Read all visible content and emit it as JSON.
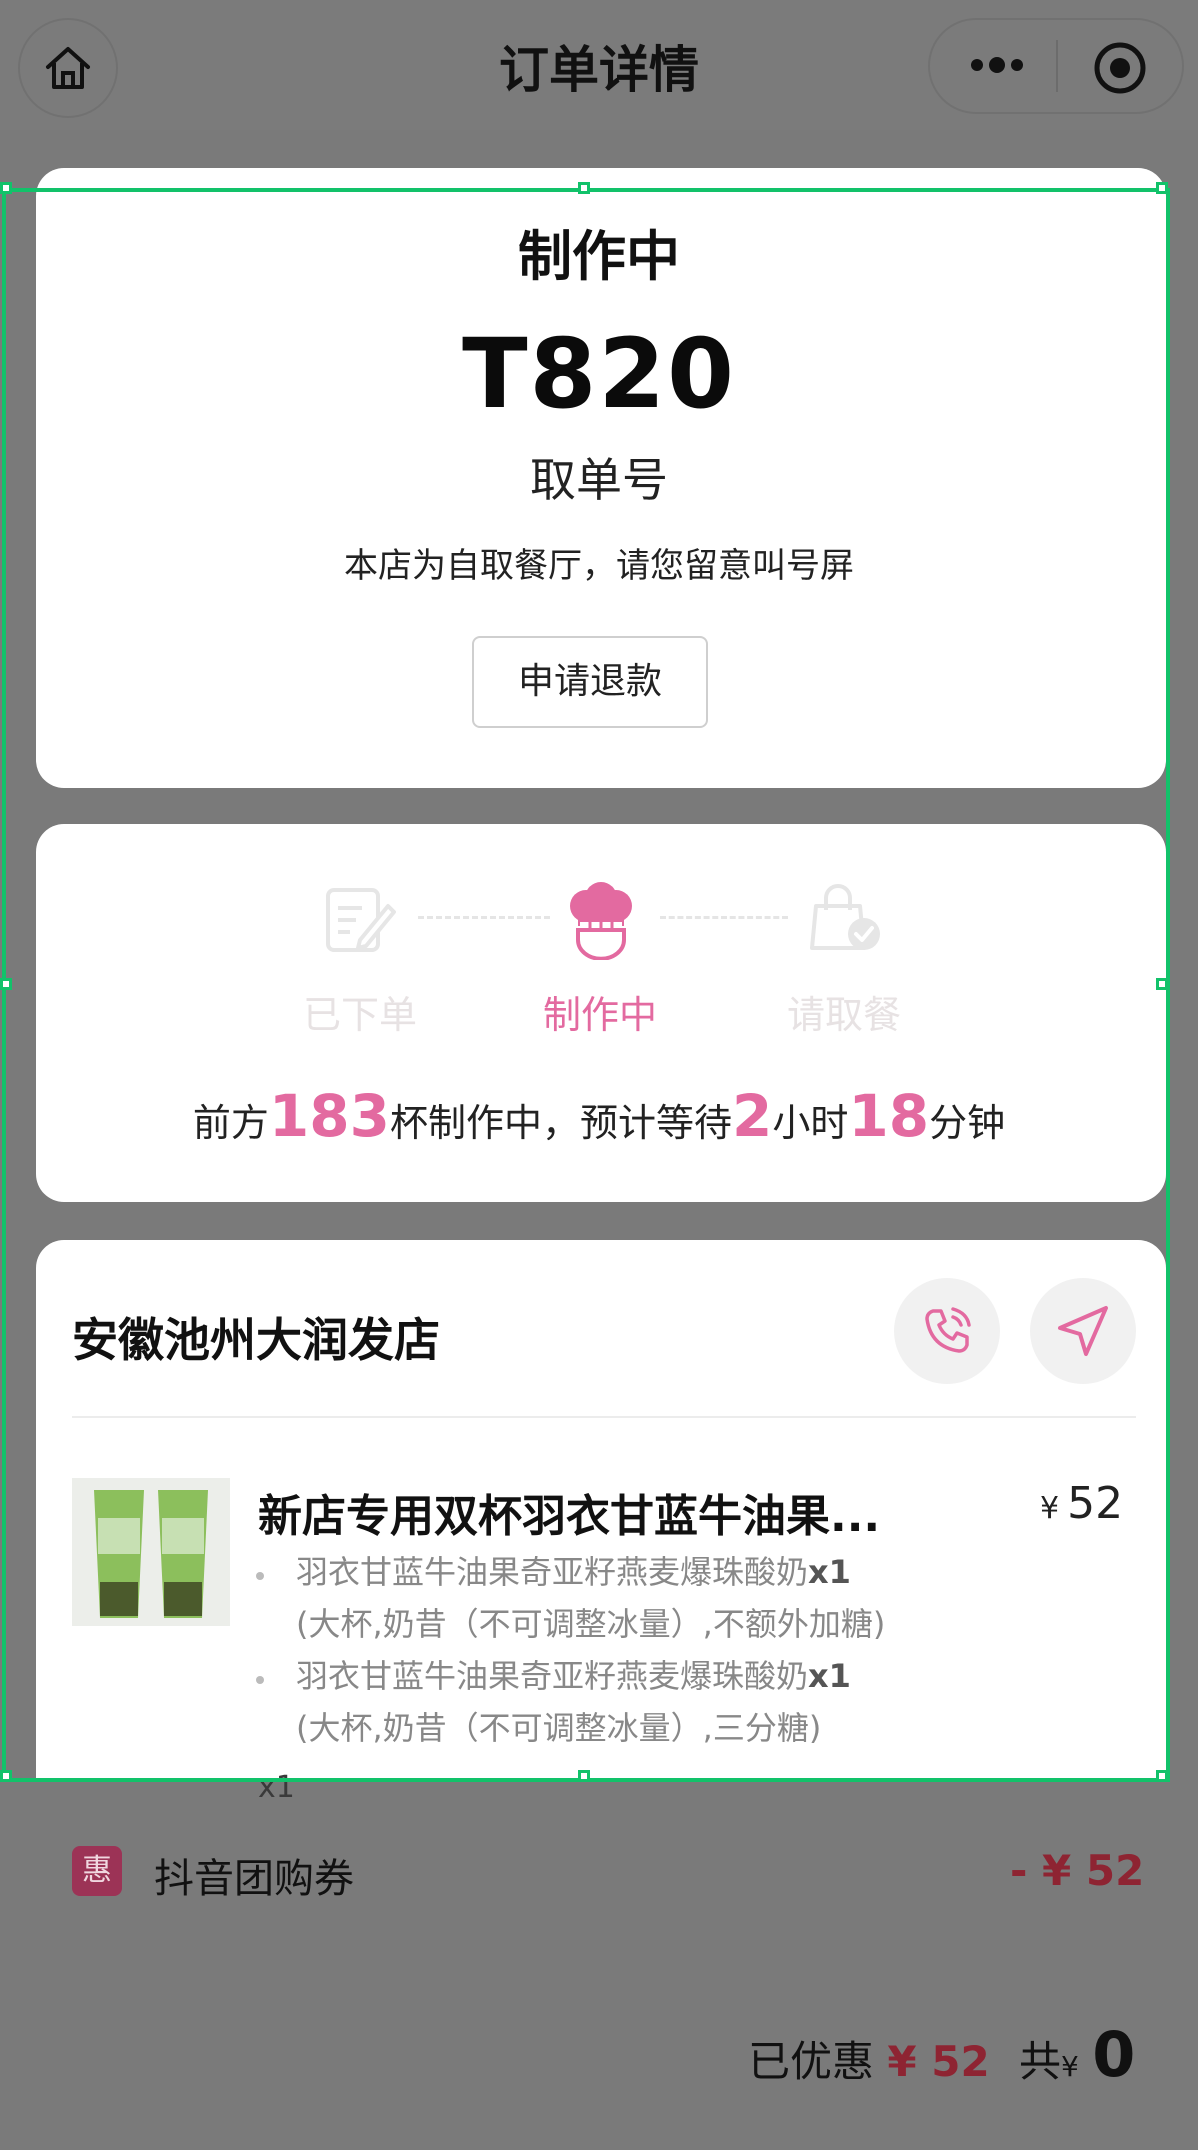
{
  "header": {
    "title": "订单详情"
  },
  "status": {
    "title": "制作中",
    "pickup_number": "T820",
    "pickup_label": "取单号",
    "notice": "本店为自取餐厅，请您留意叫号屏",
    "refund_button": "申请退款"
  },
  "progress": {
    "steps": [
      {
        "label": "已下单",
        "icon": "order-edit-icon",
        "active": false
      },
      {
        "label": "制作中",
        "icon": "chef-hat-icon",
        "active": true
      },
      {
        "label": "请取餐",
        "icon": "bag-check-icon",
        "active": false
      }
    ],
    "queue": {
      "prefix": "前方",
      "cups": "183",
      "mid": "杯制作中，预计等待",
      "hours": "2",
      "hours_unit": "小时",
      "minutes": "18",
      "minutes_unit": "分钟"
    }
  },
  "store": {
    "name": "安徽池州大润发店",
    "phone_icon": "phone-icon",
    "navigate_icon": "navigate-icon"
  },
  "product": {
    "name": "新店专用双杯羽衣甘蓝牛油果...",
    "currency": "¥",
    "price": "52",
    "options": [
      {
        "name": "羽衣甘蓝牛油果奇亚籽燕麦爆珠酸奶",
        "qty": "x1",
        "spec": "(大杯,奶昔（不可调整冰量）,不额外加糖)"
      },
      {
        "name": "羽衣甘蓝牛油果奇亚籽燕麦爆珠酸奶",
        "qty": "x1",
        "spec": "(大杯,奶昔（不可调整冰量）,三分糖)"
      }
    ],
    "quantity": "x1"
  },
  "discount": {
    "badge": "惠",
    "label": "抖音团购券",
    "amount": "- ¥ 52"
  },
  "summary": {
    "discounted_label": "已优惠",
    "discounted_amount": "¥ 52",
    "total_label": "共",
    "total_currency": "¥",
    "total": "0"
  },
  "colors": {
    "accent_pink": "#e36aa0",
    "discount_red": "#8e2432",
    "selection_green": "#12c26a"
  }
}
